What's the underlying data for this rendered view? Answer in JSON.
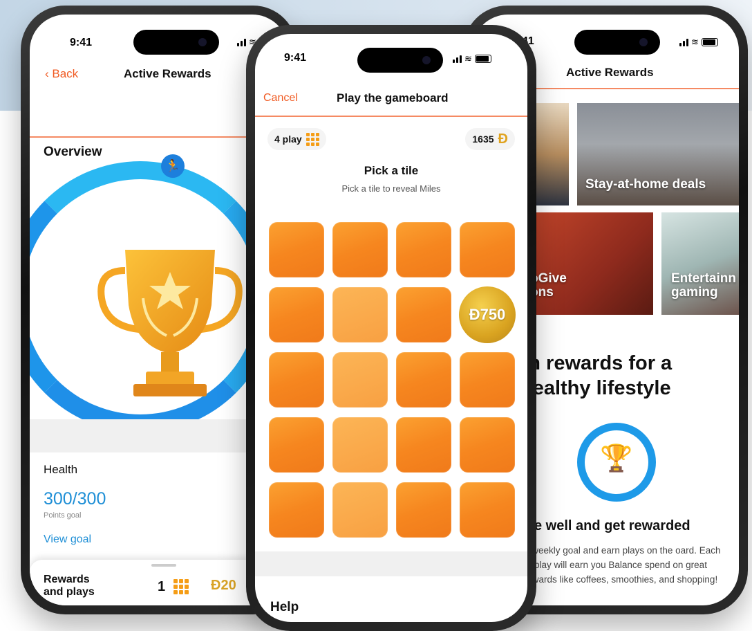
{
  "left_phone": {
    "time": "9:41",
    "back_label": "Back",
    "title": "Active Rewards",
    "overview_label": "Overview",
    "health_label": "Health",
    "points_value": "300/300",
    "points_label": "Points goal",
    "view_goal_label": "View goal",
    "rewards_label": "Rewards and plays",
    "plays_count": "1",
    "miles_value": "Ð20"
  },
  "middle_phone": {
    "time": "9:41",
    "cancel_label": "Cancel",
    "title": "Play the gameboard",
    "plays_pill": "4 play",
    "miles_balance": "1635",
    "pick_title": "Pick a tile",
    "pick_subtitle": "Pick a tile to reveal Miles",
    "revealed_tile_value": "Ð750",
    "help_label": "Help",
    "board": {
      "rows": 5,
      "columns": 4,
      "revealed_row": 2,
      "revealed_column": 4
    }
  },
  "right_phone": {
    "time": "41",
    "title": "Active Rewards",
    "deal_tiles": [
      {
        "caption": "Stay-at-home deals"
      },
      {
        "caption": "oGive\nons"
      },
      {
        "caption": "Entertainn\ngaming"
      }
    ],
    "earn_title": "rn rewards for a healthy lifestyle",
    "live_title": "e well and get rewarded",
    "live_text": "ur weekly goal and earn plays on the oard. Each play will earn you Balance spend on great rewards like coffees, smoothies, and shopping!"
  },
  "colors": {
    "accent_orange": "#f05a22",
    "ring_blue": "#22a7ee",
    "tile_orange": "#f6861f",
    "coin_gold": "#d9a320",
    "link_blue": "#1f8fd6"
  },
  "icons": {
    "trophy": "trophy-icon",
    "runner": "runner-icon",
    "grid": "grid-icon",
    "coin": "miles-coin-icon"
  }
}
